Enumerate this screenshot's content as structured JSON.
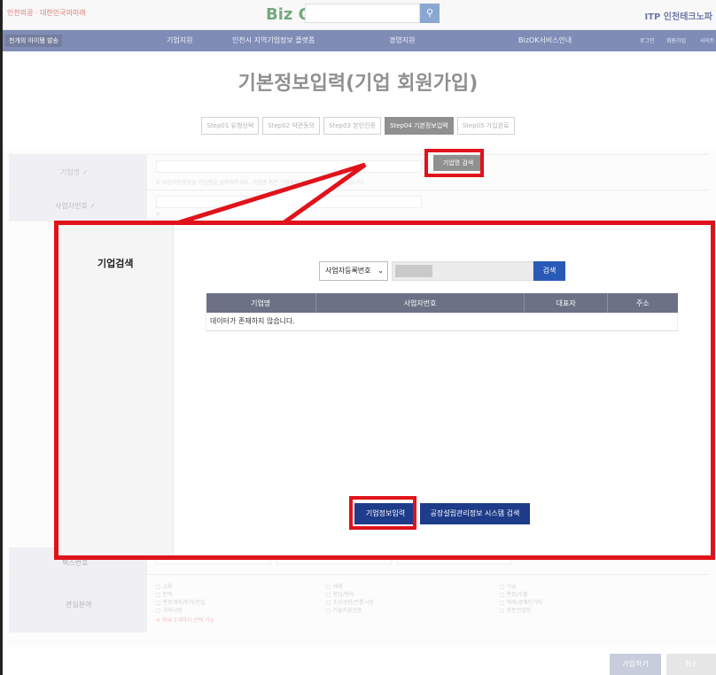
{
  "header": {
    "left_logo": "인천의꿈 · 대한민국의미래",
    "brand": "Biz OK",
    "search_icon": "search-icon",
    "right_logo": "ITP 인천테크노파"
  },
  "nav": {
    "special": "천개의 아이템 발송",
    "items": [
      "기업지원",
      "인천시 지역기업정보 플랫폼",
      "경영지원",
      "BizOK서비스안내"
    ],
    "util": [
      "로그인",
      "회원가입",
      "사이트"
    ]
  },
  "page": {
    "title": "기본정보입력(기업 회원가입)",
    "steps": [
      "Step01 유형선택",
      "Step02 약관동의",
      "Step03 본인인증",
      "Step04 기본정보입력",
      "Step05 가입완료"
    ],
    "active_step": 3
  },
  "form": {
    "rows": [
      "기업명 ✓",
      "사업자번호 ✓",
      "팩스번호",
      "관심분야"
    ],
    "corp_search_button": "기업명 검색",
    "notice1": "※ 사업자등록증상 기업명을 입력해주세요. 기업명 등은 기업회원가입이후 변경할 수 없습니다.",
    "notice2": "※",
    "interest_options": [
      [
        "□ 금융",
        "□ 인력",
        "□ 판로개척/투자/컨설",
        "□ 국외시장"
      ],
      [
        "□ 세제",
        "□ 창업/벤처",
        "□ 소상공인/전통시장",
        "□ 기술지원인증"
      ],
      [
        "□ 기술",
        "□ 판로/수출",
        "□ 해외/경제단기타",
        "□ 방문컨설팅"
      ]
    ],
    "interest_notice": "※ 최대 3개까지 선택 가능",
    "signup_button": "가입하기",
    "cancel_button": "취소"
  },
  "modal": {
    "title": "기업검색",
    "select_value": "사업자등록번호",
    "search_button": "검색",
    "columns": [
      "기업명",
      "사업자번호",
      "대표자",
      "주소"
    ],
    "empty_message": "데이터가 존재하지 않습니다.",
    "enter_button": "기업정보입력",
    "factory_button": "공장설립관리정보 시스템 검색"
  },
  "colors": {
    "highlight": "#e0131b",
    "primary_button": "#1f3c8a",
    "table_header": "#6b7285",
    "search_button": "#2a5ab8"
  }
}
